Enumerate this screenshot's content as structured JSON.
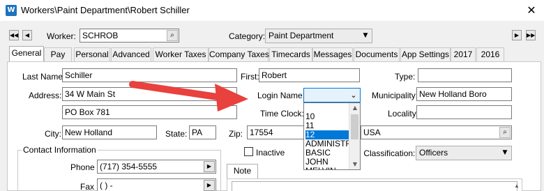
{
  "window": {
    "title": "Workers\\Paint Department\\Robert Schiller",
    "app_icon_glyph": "W",
    "close_glyph": "✕"
  },
  "header": {
    "worker_label": "Worker:",
    "worker_value": "SCHROB",
    "category_label": "Category:",
    "category_value": "Paint Department"
  },
  "nav": {
    "first": "◀◀",
    "prev": "◀",
    "next": "▶",
    "last": "▶▶"
  },
  "tabs": [
    "General",
    "Pay",
    "Personal",
    "Advanced",
    "Worker Taxes",
    "Company Taxes",
    "Timecards",
    "Messages",
    "Documents",
    "App Settings",
    "2017",
    "2016"
  ],
  "form": {
    "last_name_label": "Last Name:",
    "last_name_value": "Schiller",
    "first_label": "First:",
    "first_value": "Robert",
    "type_label": "Type:",
    "type_value": "",
    "address_label": "Address:",
    "address1_value": "34 W Main St",
    "address2_value": "PO Box 781",
    "login_name_label": "Login Name:",
    "login_name_value": "",
    "municipality_label": "Municipality:",
    "municipality_value": "New Holland Boro",
    "time_clock_label": "Time Clock:",
    "locality_label": "Locality:",
    "locality_value": "",
    "city_label": "City:",
    "city_value": "New Holland",
    "state_label": "State:",
    "state_value": "PA",
    "zip_label": "Zip:",
    "zip_value": "17554",
    "country_value": "USA",
    "inactive_label": "Inactive",
    "classification_label": "p. Classification:",
    "classification_value": "Officers",
    "contact_group_label": "Contact Information",
    "phone_label": "Phone",
    "phone_value": "(717) 354-5555",
    "fax_label": "Fax",
    "fax_value": "(   )   -",
    "note_tab_label": "Note"
  },
  "dropdown": {
    "options": [
      "10",
      "11",
      "12",
      "ADMINISTR",
      "BASIC",
      "JOHN",
      "MELVIN"
    ],
    "selected": "12"
  },
  "icons": {
    "lookup": "⌕",
    "combo_arrow": "▼",
    "phone_btn": "▶",
    "scroll_up": "▲",
    "scroll_down": "▼"
  },
  "annotation": {
    "arrow_color": "#e8413e"
  }
}
